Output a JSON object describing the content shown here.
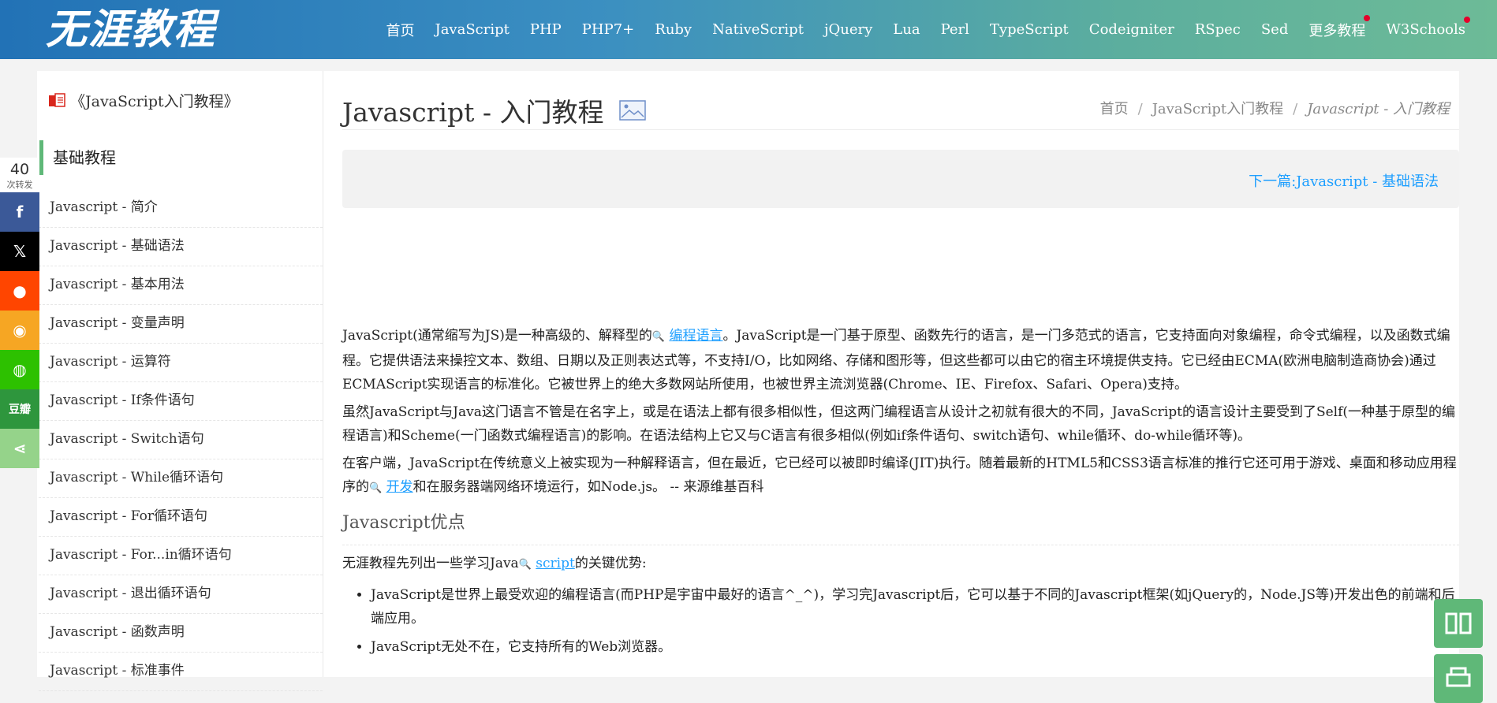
{
  "site": {
    "logo": "无涯教程"
  },
  "nav": {
    "items": [
      {
        "label": "首页"
      },
      {
        "label": "JavaScript"
      },
      {
        "label": "PHP"
      },
      {
        "label": "PHP7+"
      },
      {
        "label": "Ruby"
      },
      {
        "label": "NativeScript"
      },
      {
        "label": "jQuery"
      },
      {
        "label": "Lua"
      },
      {
        "label": "Perl"
      },
      {
        "label": "TypeScript"
      },
      {
        "label": "Codeigniter"
      },
      {
        "label": "RSpec"
      },
      {
        "label": "Sed"
      },
      {
        "label": "更多教程"
      },
      {
        "label": "W3Schools"
      }
    ]
  },
  "share": {
    "count": "40",
    "count_label": "次转发",
    "buttons": [
      {
        "icon": "facebook-icon",
        "glyph": "f",
        "color": "#3b5998"
      },
      {
        "icon": "x-icon",
        "glyph": "𝕏",
        "color": "#000000"
      },
      {
        "icon": "reddit-icon",
        "glyph": "●",
        "color": "#ff4500"
      },
      {
        "icon": "weibo-icon",
        "glyph": "◉",
        "color": "#f6a623"
      },
      {
        "icon": "wechat-icon",
        "glyph": "◍",
        "color": "#2dc100"
      },
      {
        "icon": "douban-icon",
        "glyph": "豆瓣",
        "color": "#2e963d"
      },
      {
        "icon": "share-icon",
        "glyph": "⋖",
        "color": "#95d38a"
      }
    ]
  },
  "sidebar": {
    "book_title": "《JavaScript入门教程》",
    "section": "基础教程",
    "items": [
      {
        "label": "Javascript - 简介"
      },
      {
        "label": "Javascript - 基础语法"
      },
      {
        "label": "Javascript - 基本用法"
      },
      {
        "label": "Javascript - 变量声明"
      },
      {
        "label": "Javascript - 运算符"
      },
      {
        "label": "Javascript - If条件语句"
      },
      {
        "label": "Javascript - Switch语句"
      },
      {
        "label": "Javascript - While循环语句"
      },
      {
        "label": "Javascript - For循环语句"
      },
      {
        "label": "Javascript - For...in循环语句"
      },
      {
        "label": "Javascript - 退出循环语句"
      },
      {
        "label": "Javascript - 函数声明"
      },
      {
        "label": "Javascript - 标准事件"
      }
    ]
  },
  "main": {
    "title": "Javascript - 入门教程",
    "breadcrumb": {
      "home": "首页",
      "parent": "JavaScript入门教程",
      "current": "Javascript - 入门教程",
      "sep": "/"
    },
    "next_link": "下一篇:Javascript - 基础语法",
    "p1_a": "JavaScript(通常缩写为JS)是一种高级的、解释型的",
    "p1_link": "编程语言",
    "p1_b": "。JavaScript是一门基于原型、函数先行的语言，是一门多范式的语言，它支持面向对象编程，命令式编程，以及函数式编程。它提供语法来操控文本、数组、日期以及正则表达式等，不支持I/O，比如网络、存储和图形等，但这些都可以由它的宿主环境提供支持。它已经由ECMA(欧洲电脑制造商协会)通过ECMAScript实现语言的标准化。它被世界上的绝大多数网站所使用，也被世界主流浏览器(Chrome、IE、Firefox、Safari、Opera)支持。",
    "p2": "虽然JavaScript与Java这门语言不管是在名字上，或是在语法上都有很多相似性，但这两门编程语言从设计之初就有很大的不同，JavaScript的语言设计主要受到了Self(一种基于原型的编程语言)和Scheme(一门函数式编程语言)的影响。在语法结构上它又与C语言有很多相似(例如if条件语句、switch语句、while循环、do-while循环等)。",
    "p3_a": "在客户端，JavaScript在传统意义上被实现为一种解释语言，但在最近，它已经可以被即时编译(JIT)执行。随着最新的HTML5和CSS3语言标准的推行它还可用于游戏、桌面和移动应用程序的",
    "p3_link": "开发",
    "p3_b": "和在服务器端网络环境运行，如Node.js。   -- 来源维基百科",
    "h3": "Javascript优点",
    "p4_a": "无涯教程先列出一些学习Java",
    "p4_link": "script",
    "p4_b": "的关键优势:",
    "bullets": [
      "JavaScript是世界上最受欢迎的编程语言(而PHP是宇宙中最好的语言^_^)，学习完Javascript后，它可以基于不同的Javascript框架(如jQuery的，Node.JS等)开发出色的前端和后端应用。",
      "JavaScript无处不在，它支持所有的Web浏览器。"
    ]
  }
}
